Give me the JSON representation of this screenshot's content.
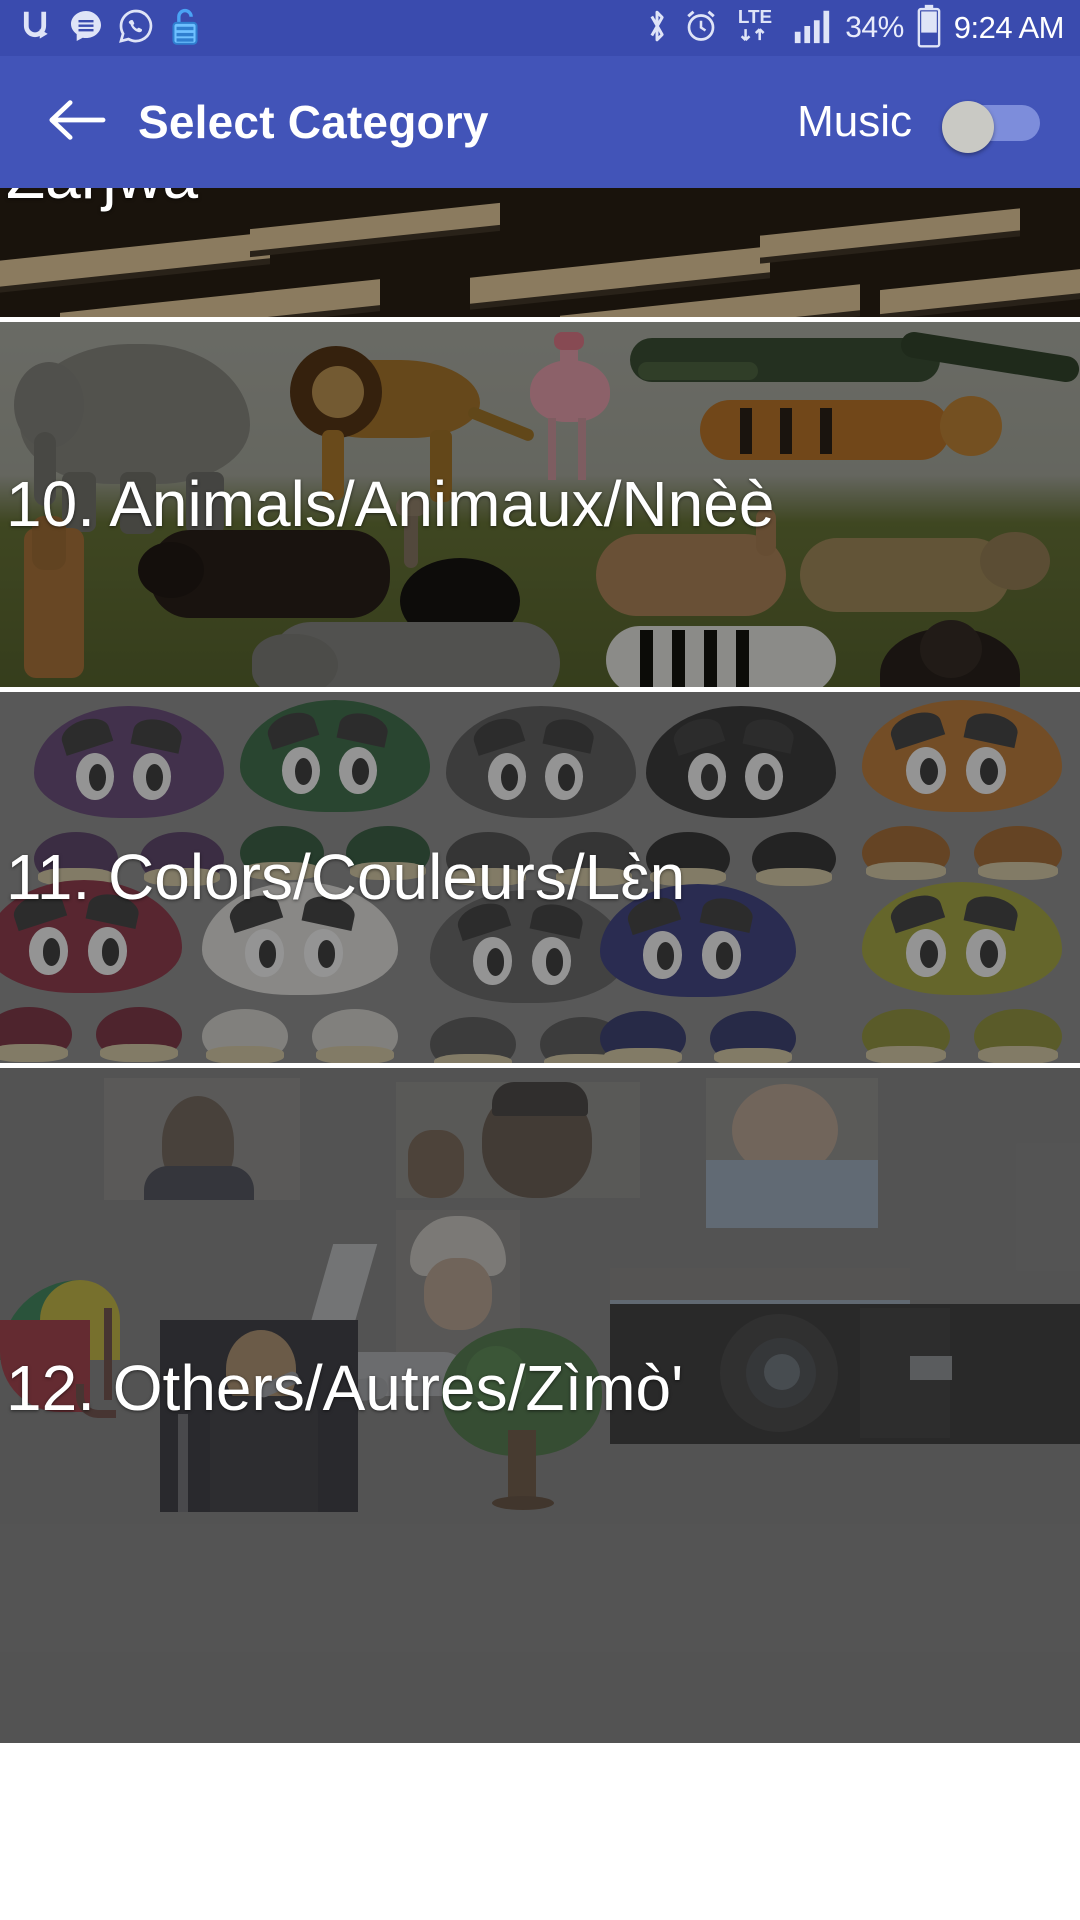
{
  "statusbar": {
    "icons": [
      "ultra-data-icon",
      "message-icon",
      "whatsapp-icon",
      "unlock-icon",
      "bluetooth-icon",
      "alarm-icon",
      "lte-icon",
      "signal-icon",
      "battery-icon"
    ],
    "network_type": "LTE",
    "battery_percent": "34%",
    "time": "9:24 AM",
    "background_color": "#3a4bae"
  },
  "appbar": {
    "back_icon": "arrow-left-icon",
    "title": "Select Category",
    "music_label": "Music",
    "music_toggle_state": "off",
    "background_color": "#4254b8",
    "text_color": "#ffffff"
  },
  "list": {
    "items": [
      {
        "label": "Zaŋwaʰ",
        "scrolled_partially": true,
        "image_theme": "school-desks-photo"
      },
      {
        "number": "10.",
        "label": "10. Animals/Animaux/Nnèè",
        "line1": "10. Animals/Animaux/",
        "line2": "Nnèè",
        "image_theme": "african-animals-collage"
      },
      {
        "number": "11.",
        "label": "11. Colors/Couleurs/Lɛ̀n",
        "line1": "11. Colors/Couleurs/Lɛ̀n",
        "image_theme": "colored-characters-grid"
      },
      {
        "number": "12.",
        "label": "12. Others/Autres/Zìmò'",
        "line1": "12. Others/Autres/Zìmò'",
        "image_theme": "mixed-photo-collage"
      }
    ]
  },
  "colors": {
    "accent": "#4254b8",
    "statusbar": "#3a4bae",
    "toggle_track": "#7d8ddb",
    "toggle_thumb": "#c9c9c4",
    "card_label": "#ffffff",
    "divider": "#ffffff"
  }
}
